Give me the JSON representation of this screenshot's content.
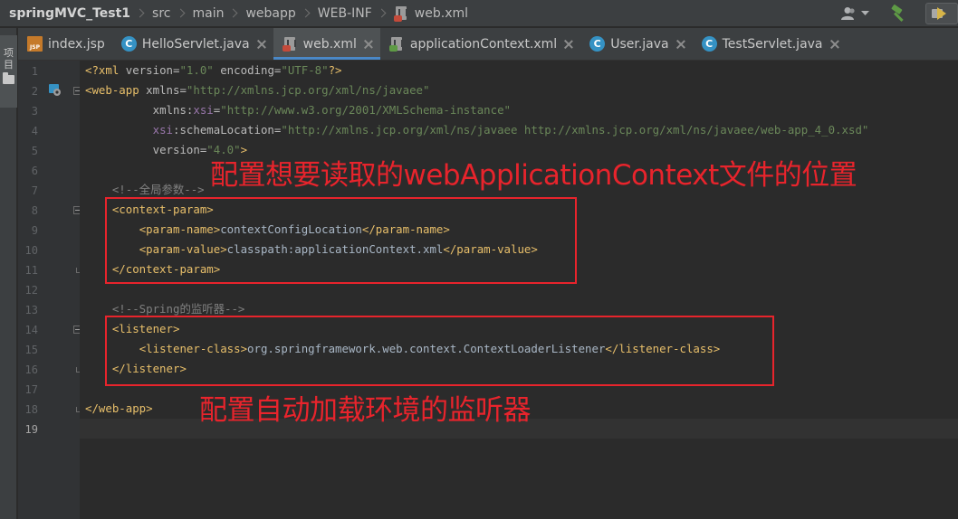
{
  "breadcrumb": {
    "project": "springMVC_Test1",
    "segments": [
      "src",
      "main",
      "webapp",
      "WEB-INF"
    ],
    "file": "web.xml"
  },
  "toolwindow": {
    "project_label": "项目"
  },
  "tabs": [
    {
      "label": "index.jsp",
      "icon": "jsp-file-icon",
      "active": false
    },
    {
      "label": "HelloServlet.java",
      "icon": "java-class-icon",
      "active": false
    },
    {
      "label": "web.xml",
      "icon": "xml-file-icon",
      "active": true
    },
    {
      "label": "applicationContext.xml",
      "icon": "xml-file-icon",
      "active": false
    },
    {
      "label": "User.java",
      "icon": "java-class-icon",
      "active": false
    },
    {
      "label": "TestServlet.java",
      "icon": "java-class-icon",
      "active": false
    }
  ],
  "editor": {
    "line_numbers": [
      "1",
      "2",
      "3",
      "4",
      "5",
      "6",
      "7",
      "8",
      "9",
      "10",
      "11",
      "12",
      "13",
      "14",
      "15",
      "16",
      "17",
      "18",
      "19"
    ],
    "lines": {
      "l1_pi": "<?xml",
      "l1_a1": " version=",
      "l1_v1": "\"1.0\"",
      "l1_a2": " encoding=",
      "l1_v2": "\"UTF-8\"",
      "l1_end": "?>",
      "l2_tag": "<web-app",
      "l2_attr": " xmlns=",
      "l2_val": "\"http://xmlns.jcp.org/xml/ns/javaee\"",
      "l3_attr": "xmlns:",
      "l3_ns": "xsi",
      "l3_eq": "=",
      "l3_val": "\"http://www.w3.org/2001/XMLSchema-instance\"",
      "l4_ns": "xsi",
      "l4_attr": ":schemaLocation=",
      "l4_val": "\"http://xmlns.jcp.org/xml/ns/javaee http://xmlns.jcp.org/xml/ns/javaee/web-app_4_0.xsd\"",
      "l5_attr": "version=",
      "l5_val": "\"4.0\"",
      "l5_end": ">",
      "l7_com": "<!--全局参数-->",
      "l8_tag": "<context-param>",
      "l9_open": "<param-name>",
      "l9_text": "contextConfigLocation",
      "l9_close": "</param-name>",
      "l10_open": "<param-value>",
      "l10_text": "classpath:applicationContext.xml",
      "l10_close": "</param-value>",
      "l11_tag": "</context-param>",
      "l13_com": "<!--Spring的监听器-->",
      "l14_tag": "<listener>",
      "l15_open": "<listener-class>",
      "l15_text": "org.springframework.web.context.ContextLoaderListener",
      "l15_close": "</listener-class>",
      "l16_tag": "</listener>",
      "l18_tag": "</web-app>"
    }
  },
  "annotations": {
    "top": "配置想要读取的webApplicationContext文件的位置",
    "bottom": "配置自动加载环境的监听器",
    "color": "#e8242c"
  },
  "colors": {
    "tag": "#e8bf6a",
    "attribute": "#bababa",
    "namespace": "#9876aa",
    "string": "#6a8759",
    "comment": "#808080",
    "text": "#a9b7c6",
    "active_tab_underline": "#4a88c7"
  }
}
